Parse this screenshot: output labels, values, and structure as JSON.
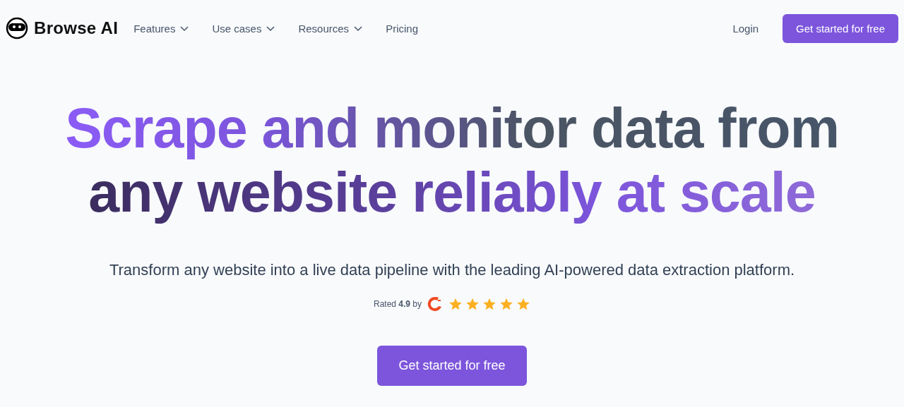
{
  "header": {
    "brand": "Browse AI",
    "nav": [
      {
        "label": "Features",
        "kind": "dropdown"
      },
      {
        "label": "Use cases",
        "kind": "dropdown"
      },
      {
        "label": "Resources",
        "kind": "dropdown"
      },
      {
        "label": "Pricing",
        "kind": "link"
      }
    ],
    "login": "Login",
    "cta": "Get started for free"
  },
  "hero": {
    "headline": [
      "Scrape and monitor data from",
      "any website reliably at scale"
    ],
    "subtitle": "Transform any website into a live data pipeline with the leading AI-powered data extraction platform.",
    "rating": {
      "text": "Rated **4.9** by",
      "stars": 5
    },
    "cta": "Get started for free"
  }
}
